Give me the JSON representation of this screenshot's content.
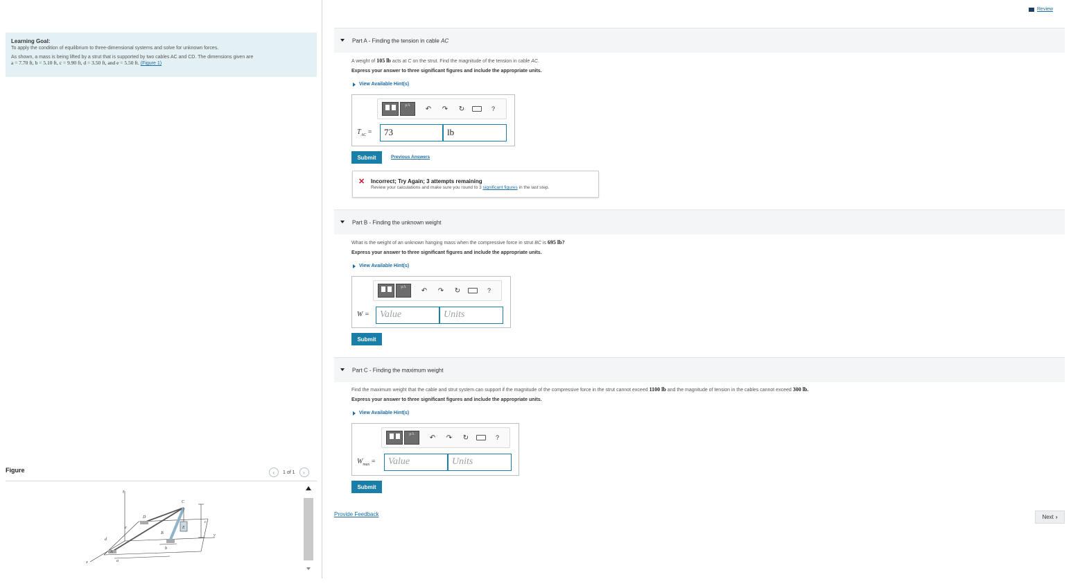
{
  "review": {
    "label": "Review"
  },
  "learning_goal": {
    "title": "Learning Goal:",
    "text": "To apply the condition of equilibrium to three-dimensional systems and solve for unknown forces.",
    "description": "As shown, a mass is being lifted by a strut that is supported by two cables AC and CD. The dimensions given are",
    "values": "a = 7.70 ft, b = 5.10 ft, c = 9.90 ft, d = 3.50 ft, and e = 5.50 ft.",
    "figure_link": "(Figure 1)"
  },
  "figure": {
    "label": "Figure",
    "pager": "1 of 1",
    "labels": {
      "z": "z",
      "c": "c",
      "D": "D",
      "C": "C",
      "E": "E",
      "B": "B",
      "A": "A",
      "b": "b",
      "a": "a",
      "d": "d",
      "e": "e",
      "x": "x",
      "y": "y"
    }
  },
  "part_a": {
    "title": "Part A - Finding the tension in cable ",
    "title_em": "AC",
    "question_pre": "A weight of ",
    "question_val": "105 lb",
    "question_mid": " acts at ",
    "question_pt": "C",
    "question_mid2": " on the strut. Find the magnitude of the tension in cable ",
    "question_cable": "AC",
    "question_end": ".",
    "instruction": "Express your answer to three significant figures and include the appropriate units.",
    "hint": "View Available Hint(s)",
    "label_var": "T",
    "label_sub": "AC",
    "label_eq": " =",
    "value": "73",
    "units": "lb",
    "submit": "Submit",
    "previous": "Previous Answers",
    "feedback_title": "Incorrect; Try Again; 3 attempts remaining",
    "feedback_pre": "Review your calculations and make sure you round to 3 ",
    "feedback_link": "significant figures",
    "feedback_post": " in the last step."
  },
  "part_b": {
    "title": "Part B - Finding the unknown weight",
    "question_pre": "What is the weight of an unknown hanging mass when the compressive force in strut ",
    "question_strut": "BC",
    "question_mid": " is  ",
    "question_val": "695 lb?",
    "instruction": "Express your answer to three significant figures and include the appropriate units.",
    "hint": "View Available Hint(s)",
    "label": "W =",
    "value_placeholder": "Value",
    "units_placeholder": "Units",
    "submit": "Submit"
  },
  "part_c": {
    "title": "Part C - Finding the maximum weight",
    "question_pre": "Find the maximum weight that the cable and strut system can support if the magnitude of the compressive force in the strut cannot exceed ",
    "question_val1": "1100 lb",
    "question_mid": " and the magnitude of tension in the cables cannot exceed ",
    "question_val2": "300 lb.",
    "instruction": "Express your answer to three significant figures and include the appropriate units.",
    "hint": "View Available Hint(s)",
    "label_var": "W",
    "label_sub": "max",
    "label_eq": " =",
    "value_placeholder": "Value",
    "units_placeholder": "Units",
    "submit": "Submit"
  },
  "toolbar": {
    "mu_label": "μA",
    "undo": "↶",
    "redo": "↷",
    "reset": "↻",
    "help": "?"
  },
  "footer": {
    "provide_feedback": "Provide Feedback",
    "next": "Next"
  },
  "icons": [
    "review-icon",
    "caret-down-icon",
    "hint-arrow-icon",
    "templates-icon",
    "units-icon",
    "undo-icon",
    "redo-icon",
    "reset-icon",
    "keyboard-icon",
    "help-icon",
    "incorrect-x-icon",
    "chevron-left-icon",
    "chevron-right-icon"
  ]
}
